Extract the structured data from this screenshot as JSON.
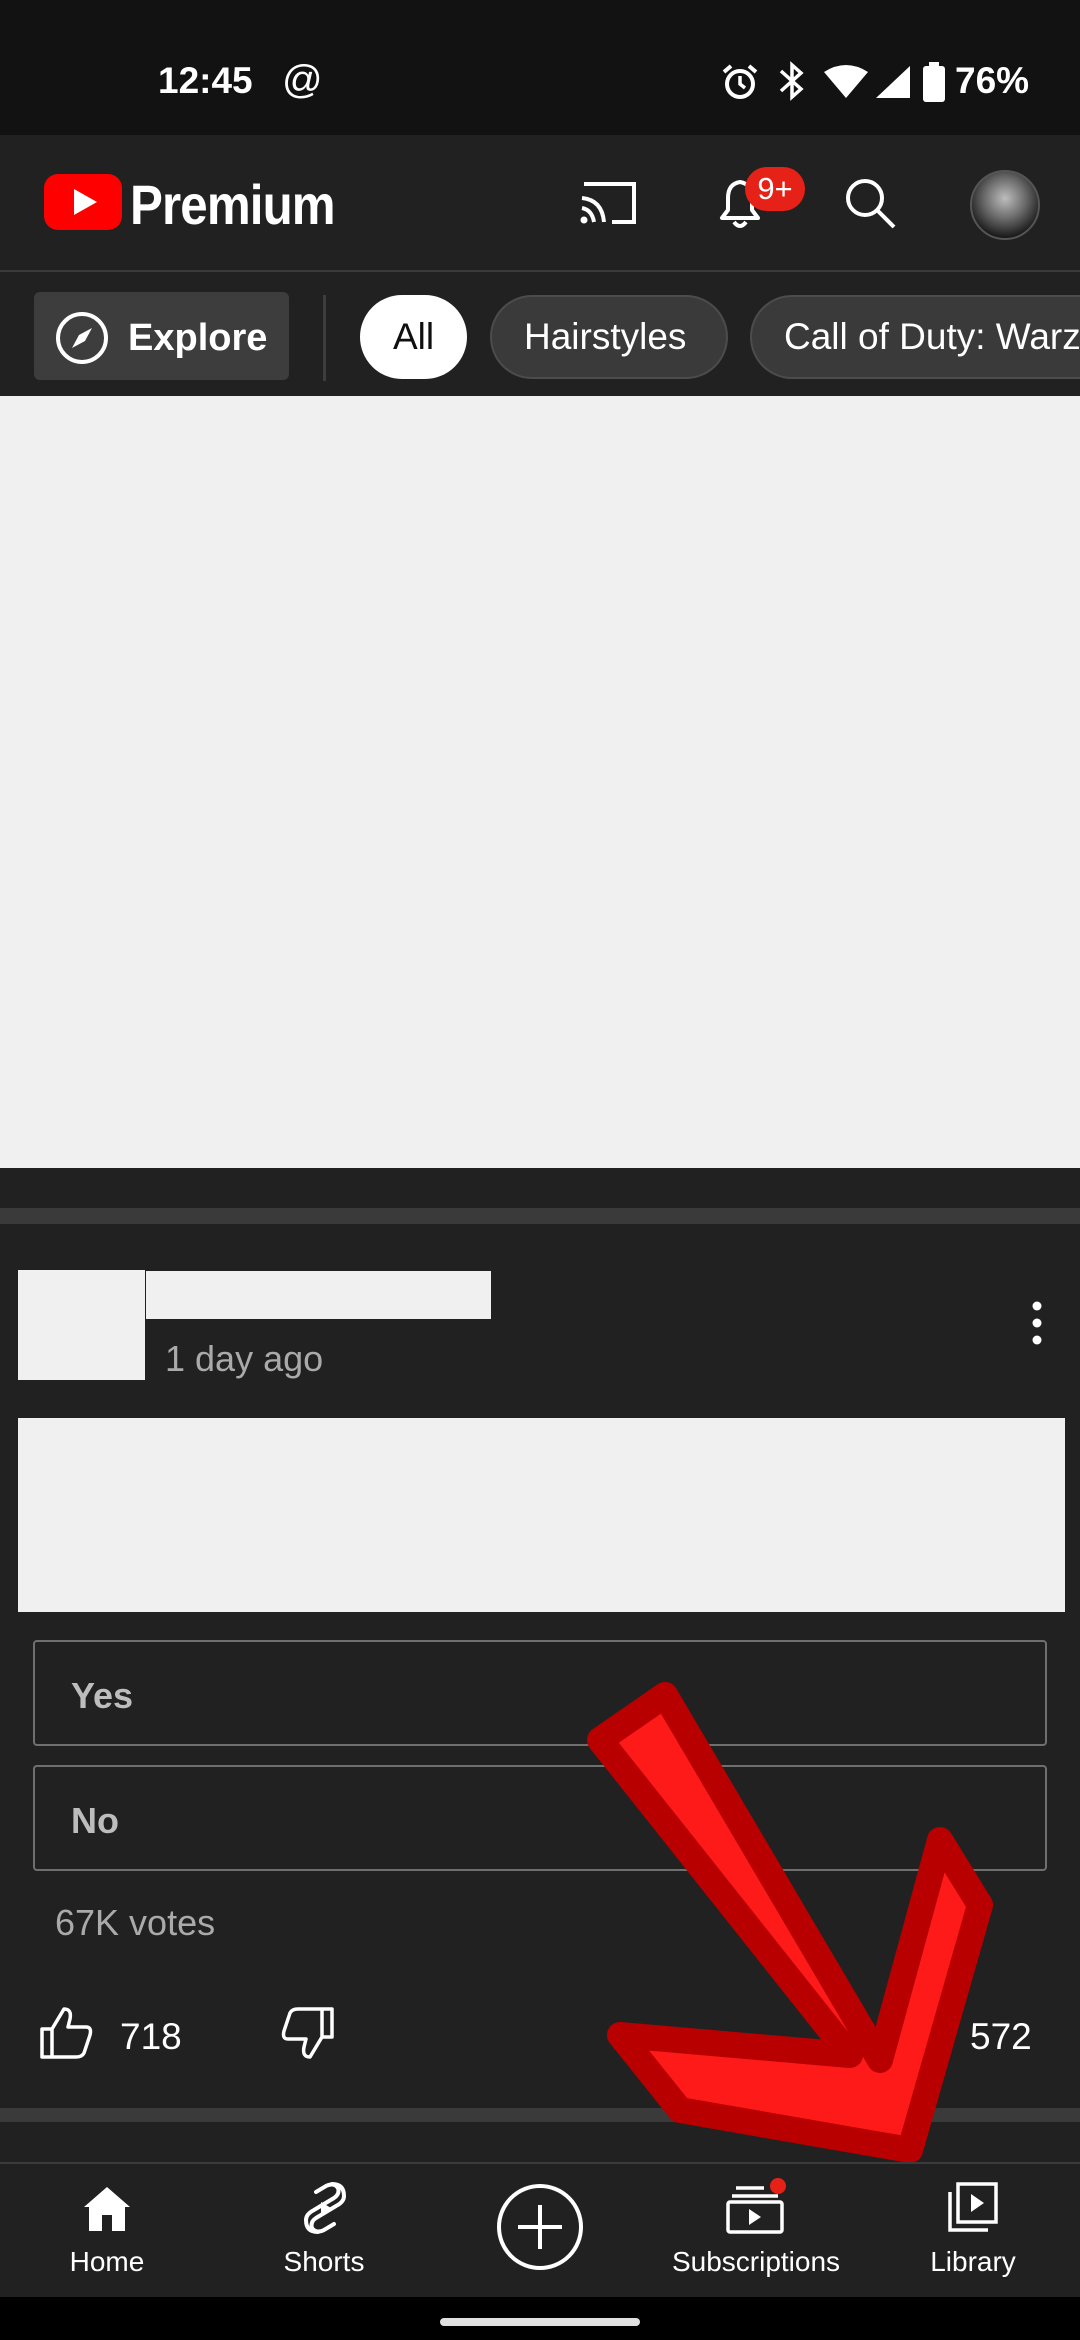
{
  "status_bar": {
    "time": "12:45",
    "at_icon": "@",
    "battery_percent": "76%"
  },
  "header": {
    "logo_text": "Premium",
    "notification_badge": "9+",
    "icons": [
      "cast-icon",
      "bell-icon",
      "search-icon",
      "avatar"
    ]
  },
  "chips": {
    "explore_label": "Explore",
    "items": [
      {
        "label": "All",
        "selected": true
      },
      {
        "label": "Hairstyles",
        "selected": false
      },
      {
        "label": "Call of Duty: Warz",
        "selected": false
      }
    ]
  },
  "post": {
    "time_ago": "1 day ago",
    "poll": {
      "options": [
        "Yes",
        "No"
      ],
      "votes": "67K votes"
    },
    "likes": "718",
    "comments": "572"
  },
  "bottom_nav": {
    "items": [
      {
        "label": "Home",
        "icon": "home-icon"
      },
      {
        "label": "Shorts",
        "icon": "shorts-icon"
      },
      {
        "label": "",
        "icon": "create-icon"
      },
      {
        "label": "Subscriptions",
        "icon": "subscriptions-icon"
      },
      {
        "label": "Library",
        "icon": "library-icon"
      }
    ]
  },
  "colors": {
    "background": "#212121",
    "brand_red": "#ff0000",
    "badge_red": "#e62117",
    "arrow_red": "#ff0000",
    "arrow_outline": "#b80000"
  }
}
